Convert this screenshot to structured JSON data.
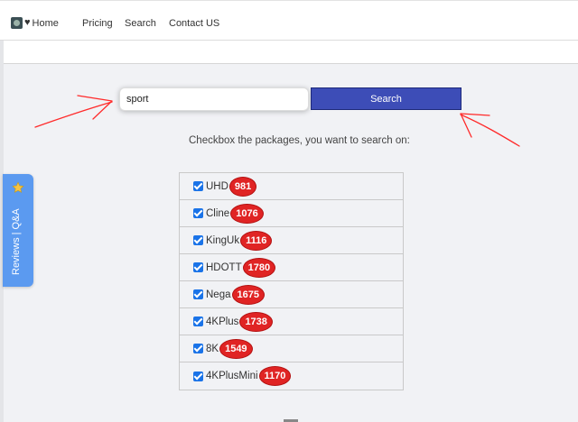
{
  "nav": {
    "home_label": "Home",
    "links": [
      "Pricing",
      "Search",
      "Contact US"
    ]
  },
  "search": {
    "value": "sport",
    "button_label": "Search"
  },
  "instructions": "Checkbox the packages, you want to search on:",
  "packages": [
    {
      "name": "UHD",
      "count": "981",
      "checked": true
    },
    {
      "name": "Cline",
      "count": "1076",
      "checked": true
    },
    {
      "name": "KingUk",
      "count": "1116",
      "checked": true
    },
    {
      "name": "HDOTT",
      "count": "1780",
      "checked": true
    },
    {
      "name": "Nega",
      "count": "1675",
      "checked": true
    },
    {
      "name": "4KPlus",
      "count": "1738",
      "checked": true
    },
    {
      "name": "8K",
      "count": "1549",
      "checked": true
    },
    {
      "name": "4KPlusMini",
      "count": "1170",
      "checked": true
    }
  ],
  "side_tab": {
    "label": "Reviews | Q&A",
    "icon": "star-icon"
  },
  "colors": {
    "button": "#3d4db7",
    "badge": "#e02424",
    "checkbox": "#1a73e8",
    "side_tab": "#5b9af0",
    "annotation": "#ff2a2a"
  }
}
